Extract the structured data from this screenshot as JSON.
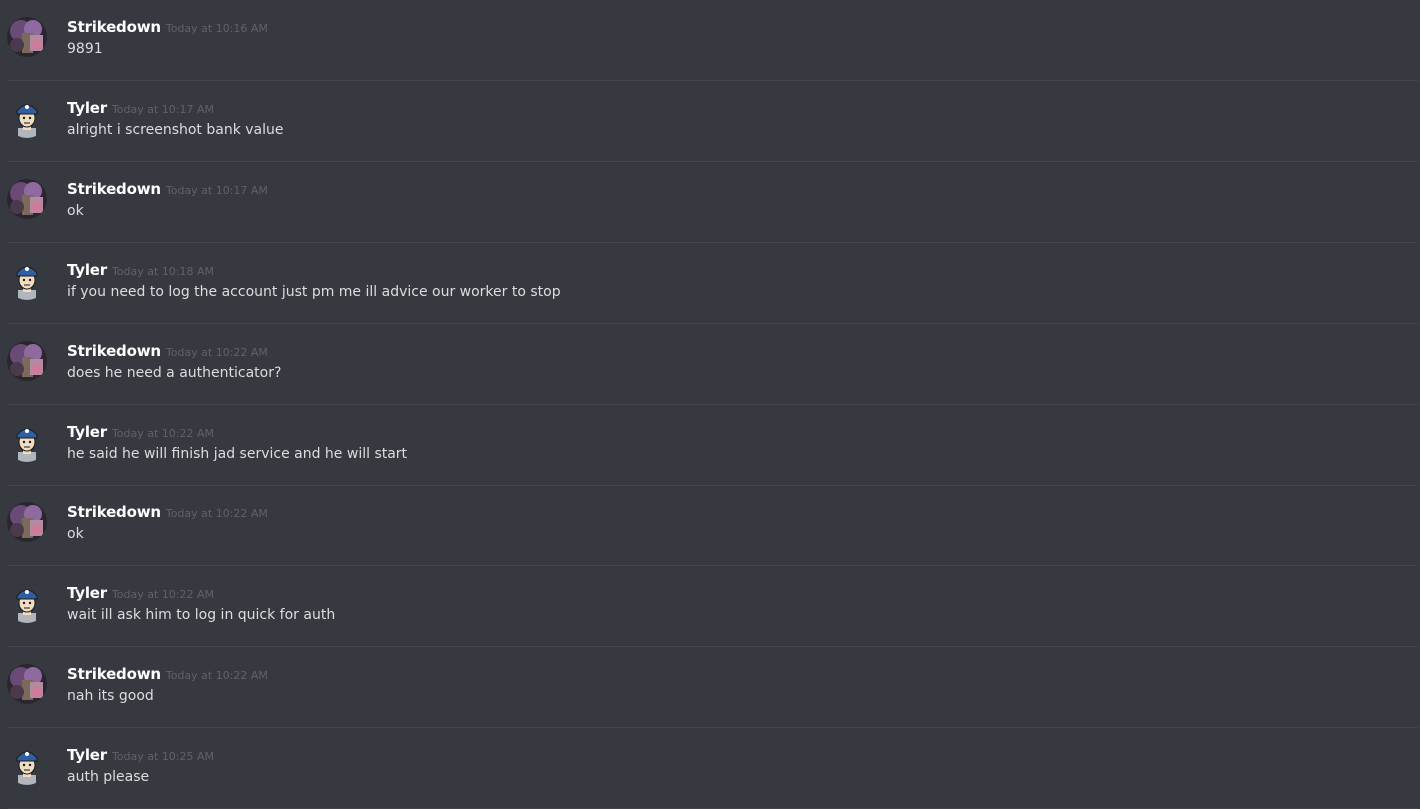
{
  "messages": [
    {
      "author": "Strikedown",
      "timestamp": "Today at 10:16 AM",
      "content": "9891",
      "avatar": "strikedown-avatar"
    },
    {
      "author": "Tyler",
      "timestamp": "Today at 10:17 AM",
      "content": "alright i screenshot bank value",
      "avatar": "tyler-avatar"
    },
    {
      "author": "Strikedown",
      "timestamp": "Today at 10:17 AM",
      "content": "ok",
      "avatar": "strikedown-avatar"
    },
    {
      "author": "Tyler",
      "timestamp": "Today at 10:18 AM",
      "content": "if you need to log the account just pm me ill advice our worker to stop",
      "avatar": "tyler-avatar"
    },
    {
      "author": "Strikedown",
      "timestamp": "Today at 10:22 AM",
      "content": "does he need a authenticator?",
      "avatar": "strikedown-avatar"
    },
    {
      "author": "Tyler",
      "timestamp": "Today at 10:22 AM",
      "content": "he said he will finish jad service and he will start",
      "avatar": "tyler-avatar"
    },
    {
      "author": "Strikedown",
      "timestamp": "Today at 10:22 AM",
      "content": "ok",
      "avatar": "strikedown-avatar"
    },
    {
      "author": "Tyler",
      "timestamp": "Today at 10:22 AM",
      "content": "wait ill ask him to log in quick for auth",
      "avatar": "tyler-avatar"
    },
    {
      "author": "Strikedown",
      "timestamp": "Today at 10:22 AM",
      "content": "nah its good",
      "avatar": "strikedown-avatar"
    },
    {
      "author": "Tyler",
      "timestamp": "Today at 10:25 AM",
      "content": "auth please",
      "avatar": "tyler-avatar"
    }
  ],
  "colors": {
    "background": "#36393f",
    "divider": "#42454b",
    "author": "#ffffff",
    "timestamp": "#5f6268",
    "content": "#dcddde"
  }
}
